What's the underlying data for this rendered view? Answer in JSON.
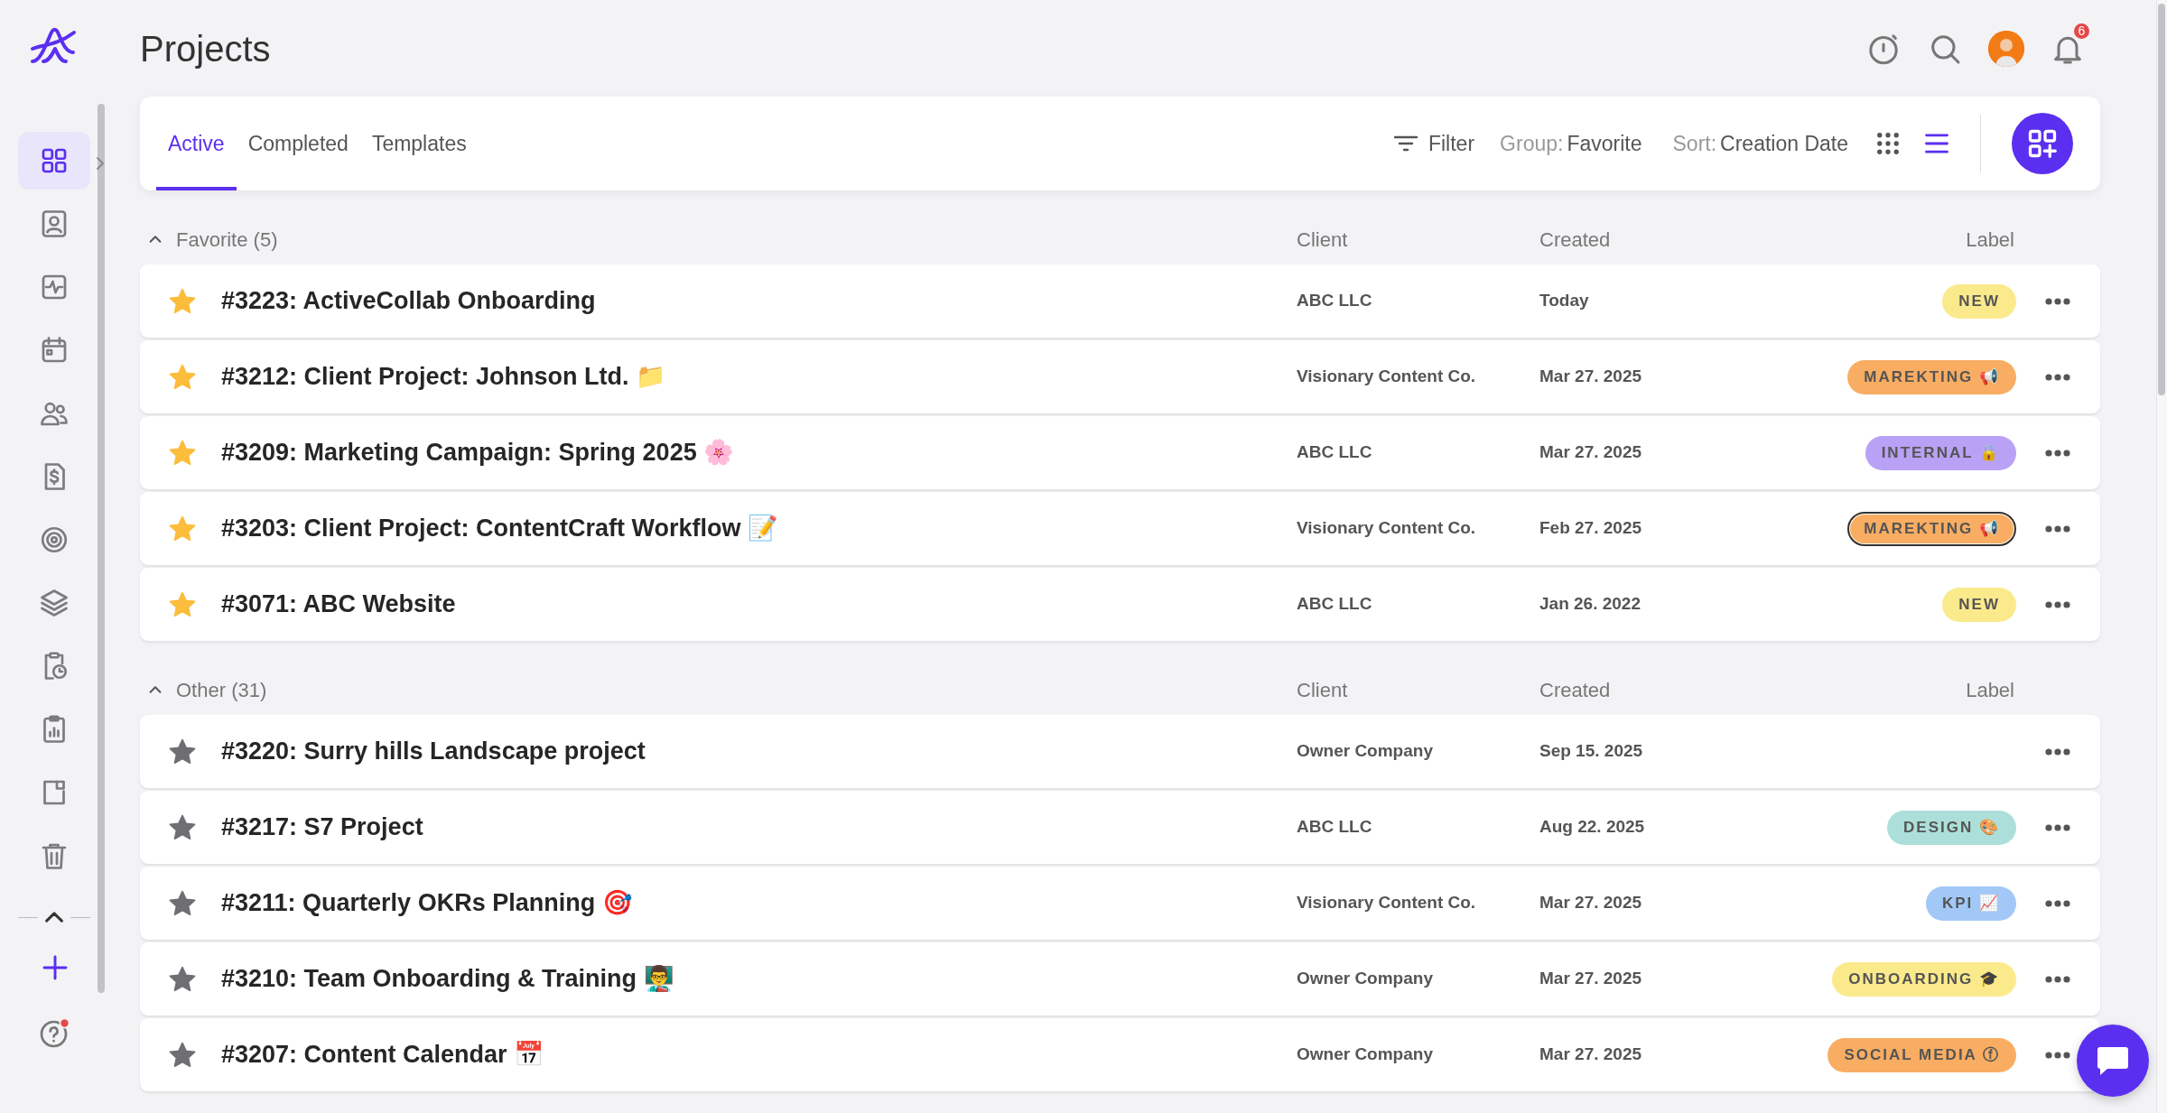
{
  "page": {
    "title": "Projects"
  },
  "header_actions": {
    "notification_count": "6"
  },
  "sidebar": {
    "items": [
      {
        "selected": true
      },
      {
        "selected": false
      },
      {
        "selected": false
      },
      {
        "selected": false
      },
      {
        "selected": false
      },
      {
        "selected": false
      },
      {
        "selected": false
      },
      {
        "selected": false
      },
      {
        "selected": false
      },
      {
        "selected": false
      },
      {
        "selected": false
      },
      {
        "selected": false
      }
    ]
  },
  "toolbar": {
    "tabs": [
      {
        "label": "Active",
        "selected": true
      },
      {
        "label": "Completed",
        "selected": false
      },
      {
        "label": "Templates",
        "selected": false
      }
    ],
    "filter": "Filter",
    "group_label": "Group:",
    "group_value": "Favorite",
    "sort_label": "Sort:",
    "sort_value": "Creation Date",
    "views": [
      {
        "selected": false
      },
      {
        "selected": true
      }
    ]
  },
  "groups": [
    {
      "title": "Favorite (5)",
      "expanded": true,
      "columns": [
        "Client",
        "Created",
        "Label"
      ],
      "rows": [
        {
          "favorite": true,
          "title": "#3223: ActiveCollab Onboarding",
          "client": "ABC LLC",
          "created": "Today",
          "label": {
            "text": "NEW",
            "color": "#fbea8c",
            "outlined": false
          }
        },
        {
          "favorite": true,
          "title": "#3212: Client Project: Johnson Ltd. 📁",
          "client": "Visionary Content Co.",
          "created": "Mar 27. 2025",
          "label": {
            "text": "MAREKTING 📢",
            "color": "#f8ad62",
            "outlined": false
          }
        },
        {
          "favorite": true,
          "title": "#3209: Marketing Campaign: Spring 2025 🌸",
          "client": "ABC LLC",
          "created": "Mar 27. 2025",
          "label": {
            "text": "INTERNAL 🔒",
            "color": "#b9a1f5",
            "outlined": false
          }
        },
        {
          "favorite": true,
          "title": "#3203: Client Project: ContentCraft Workflow 📝",
          "client": "Visionary Content Co.",
          "created": "Feb 27. 2025",
          "label": {
            "text": "MAREKTING 📢",
            "color": "#f8ad62",
            "outlined": true
          }
        },
        {
          "favorite": true,
          "title": "#3071: ABC Website",
          "client": "ABC LLC",
          "created": "Jan 26. 2022",
          "label": {
            "text": "NEW",
            "color": "#fbea8c",
            "outlined": false
          }
        }
      ]
    },
    {
      "title": "Other (31)",
      "expanded": true,
      "columns": [
        "Client",
        "Created",
        "Label"
      ],
      "rows": [
        {
          "favorite": false,
          "title": "#3220: Surry hills Landscape project",
          "client": "Owner Company",
          "created": "Sep 15. 2025"
        },
        {
          "favorite": false,
          "title": "#3217: S7 Project",
          "client": "ABC LLC",
          "created": "Aug 22. 2025",
          "label": {
            "text": "DESIGN 🎨",
            "color": "#acdfd9",
            "outlined": false
          }
        },
        {
          "favorite": false,
          "title": "#3211: Quarterly OKRs Planning 🎯",
          "client": "Visionary Content Co.",
          "created": "Mar 27. 2025",
          "label": {
            "text": "KPI 📈",
            "color": "#a2c8f8",
            "outlined": false
          }
        },
        {
          "favorite": false,
          "title": "#3210: Team Onboarding & Training 👨‍🏫",
          "client": "Owner Company",
          "created": "Mar 27. 2025",
          "label": {
            "text": "ONBOARDING 🎓",
            "color": "#fbea8c",
            "outlined": false
          }
        },
        {
          "favorite": false,
          "title": "#3207: Content Calendar 📅",
          "client": "Owner Company",
          "created": "Mar 27. 2025",
          "label": {
            "text": "SOCIAL MEDIA ⓕ",
            "color": "#f8ad62",
            "outlined": false
          }
        }
      ]
    }
  ]
}
